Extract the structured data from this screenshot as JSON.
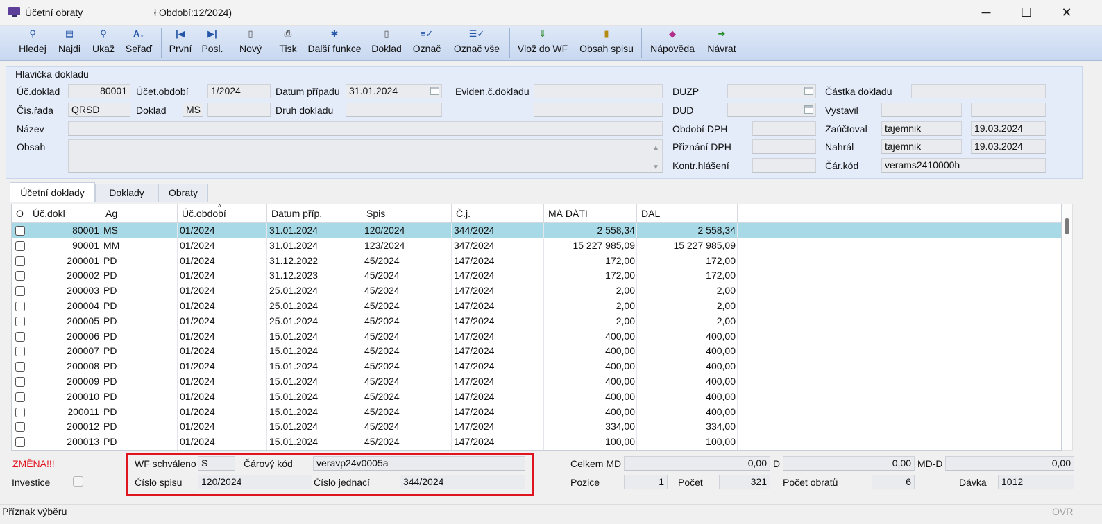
{
  "window": {
    "title": "Účetní obraty",
    "title_suffix": "Období:12/2024)",
    "minimize": "─",
    "maximize": "☐",
    "close": "✕"
  },
  "toolbar": {
    "hledej": "Hledej",
    "najdi": "Najdi",
    "ukaz": "Ukaž",
    "serad": "Seřaď",
    "prvni": "První",
    "posl": "Posl.",
    "novy": "Nový",
    "tisk": "Tisk",
    "dalsi": "Další funkce",
    "doklad": "Doklad",
    "oznac": "Označ",
    "oznac_vse": "Označ vše",
    "vloz_wf": "Vlož do WF",
    "obsah_spisu": "Obsah spisu",
    "napoveda": "Nápověda",
    "navrat": "Návrat"
  },
  "header": {
    "legend": "Hlavička dokladu",
    "uc_doklad_label": "Úč.doklad",
    "uc_doklad": "80001",
    "ucet_obdobi_label": "Účet.období",
    "ucet_obdobi": "1/2024",
    "datum_pripadu_label": "Datum případu",
    "datum_pripadu": "31.01.2024",
    "eviden_label": "Eviden.č.dokladu",
    "eviden": "",
    "duzp_label": "DUZP",
    "duzp": "",
    "castka_label": "Částka dokladu",
    "castka": "",
    "cis_rada_label": "Čís.řada",
    "cis_rada": "QRSD",
    "doklad_label": "Doklad",
    "doklad": "MS",
    "doklad2": "",
    "druh_label": "Druh dokladu",
    "druh": "",
    "eviden2": "",
    "dud_label": "DUD",
    "dud": "",
    "vystavil_label": "Vystavil",
    "vystavil": "",
    "vystavil_date": "",
    "nazev_label": "Název",
    "nazev": "",
    "obdobi_dph_label": "Období DPH",
    "obdobi_dph": "",
    "zauctoval_label": "Zaúčtoval",
    "zauctoval": "tajemnik",
    "zauctoval_date": "19.03.2024",
    "obsah_label": "Obsah",
    "obsah": "",
    "priznani_dph_label": "Přiznání DPH",
    "priznani_dph": "",
    "nahral_label": "Nahrál",
    "nahral": "tajemnik",
    "nahral_date": "19.03.2024",
    "kontr_label": "Kontr.hlášení",
    "kontr": "",
    "car_kod_label": "Čár.kód",
    "car_kod": "verams2410000h"
  },
  "tabs": [
    "Účetní doklady",
    "Doklady",
    "Obraty"
  ],
  "grid": {
    "columns": [
      "O",
      "Úč.dokl",
      "Ag",
      "Úč.období",
      "Datum příp.",
      "Spis",
      "Č.j.",
      "MÁ DÁTI",
      "DAL"
    ],
    "rows": [
      [
        "80001",
        "MS",
        "01/2024",
        "31.01.2024",
        "120/2024",
        "344/2024",
        "2 558,34",
        "2 558,34"
      ],
      [
        "90001",
        "MM",
        "01/2024",
        "31.01.2024",
        "123/2024",
        "347/2024",
        "15 227 985,09",
        "15 227 985,09"
      ],
      [
        "200001",
        "PD",
        "01/2024",
        "31.12.2022",
        "45/2024",
        "147/2024",
        "172,00",
        "172,00"
      ],
      [
        "200002",
        "PD",
        "01/2024",
        "31.12.2023",
        "45/2024",
        "147/2024",
        "172,00",
        "172,00"
      ],
      [
        "200003",
        "PD",
        "01/2024",
        "25.01.2024",
        "45/2024",
        "147/2024",
        "2,00",
        "2,00"
      ],
      [
        "200004",
        "PD",
        "01/2024",
        "25.01.2024",
        "45/2024",
        "147/2024",
        "2,00",
        "2,00"
      ],
      [
        "200005",
        "PD",
        "01/2024",
        "25.01.2024",
        "45/2024",
        "147/2024",
        "2,00",
        "2,00"
      ],
      [
        "200006",
        "PD",
        "01/2024",
        "15.01.2024",
        "45/2024",
        "147/2024",
        "400,00",
        "400,00"
      ],
      [
        "200007",
        "PD",
        "01/2024",
        "15.01.2024",
        "45/2024",
        "147/2024",
        "400,00",
        "400,00"
      ],
      [
        "200008",
        "PD",
        "01/2024",
        "15.01.2024",
        "45/2024",
        "147/2024",
        "400,00",
        "400,00"
      ],
      [
        "200009",
        "PD",
        "01/2024",
        "15.01.2024",
        "45/2024",
        "147/2024",
        "400,00",
        "400,00"
      ],
      [
        "200010",
        "PD",
        "01/2024",
        "15.01.2024",
        "45/2024",
        "147/2024",
        "400,00",
        "400,00"
      ],
      [
        "200011",
        "PD",
        "01/2024",
        "15.01.2024",
        "45/2024",
        "147/2024",
        "400,00",
        "400,00"
      ],
      [
        "200012",
        "PD",
        "01/2024",
        "15.01.2024",
        "45/2024",
        "147/2024",
        "334,00",
        "334,00"
      ],
      [
        "200013",
        "PD",
        "01/2024",
        "15.01.2024",
        "45/2024",
        "147/2024",
        "100,00",
        "100,00"
      ]
    ]
  },
  "footer": {
    "zmena": "ZMĚNA!!!",
    "investice_label": "Investice",
    "wf_label": "WF schváleno",
    "wf": "S",
    "carovy_kod_label": "Čárový kód",
    "carovy_kod": "veravp24v0005a",
    "cislo_spisu_label": "Číslo spisu",
    "cislo_spisu": "120/2024",
    "cislo_jednaci_label": "Číslo jednací",
    "cislo_jednaci": "344/2024",
    "celkem_md_label": "Celkem MD",
    "celkem_md": "0,00",
    "d_label": "D",
    "d": "0,00",
    "md_d_label": "MD-D",
    "md_d": "0,00",
    "pozice_label": "Pozice",
    "pozice": "1",
    "pocet_label": "Počet",
    "pocet": "321",
    "pocet_obratu_label": "Počet obratů",
    "pocet_obratu": "6",
    "davka_label": "Dávka",
    "davka": "1012"
  },
  "status": {
    "text": "Příznak výběru",
    "ovr": "OVR"
  },
  "colors": {
    "toolbar": "#c8d8f0",
    "selected_row": "#a8d9e6",
    "highlight_box": "#e0141e",
    "zmena": "#e0141e"
  }
}
